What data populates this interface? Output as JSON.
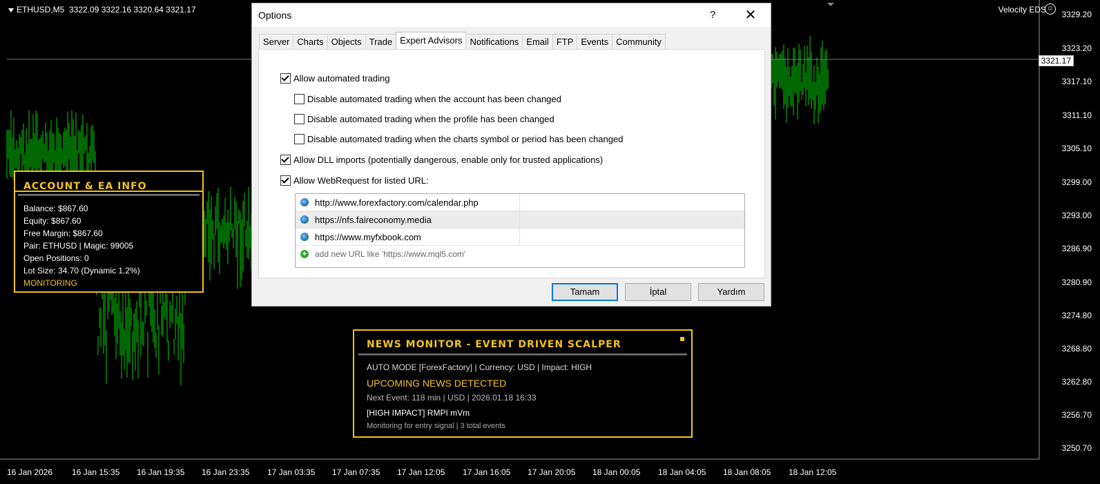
{
  "chart": {
    "header": "ETHUSD,M5  3322.09 3322.16 3320.64 3321.17",
    "ea_name": "Velocity EDS",
    "current_price": "3321.17",
    "price_labels": [
      "3329.20",
      "3323.20",
      "3317.10",
      "3311.10",
      "3305.10",
      "3299.00",
      "3293.00",
      "3286.90",
      "3280.90",
      "3274.80",
      "3268.80",
      "3262.80",
      "3256.70",
      "3250.70"
    ],
    "time_labels": [
      "16 Jan 2026",
      "16 Jan 15:35",
      "16 Jan 19:35",
      "16 Jan 23:35",
      "17 Jan 03:35",
      "17 Jan 07:35",
      "17 Jan 12:05",
      "17 Jan 16:05",
      "17 Jan 20:05",
      "18 Jan 00:05",
      "18 Jan 04:05",
      "18 Jan 08:05",
      "18 Jan 12:05"
    ],
    "colors": {
      "bars": "#00d000",
      "background": "#000000",
      "accent": "#f2c417"
    }
  },
  "account_panel": {
    "title": "ACCOUNT & EA INFO",
    "balance": "Balance: $867.60",
    "equity": "Equity: $867.60",
    "free_margin": "Free Margin: $867.60",
    "pair": "Pair: ETHUSD | Magic: 99005",
    "open_positions": "Open Positions: 0",
    "lot_size": "Lot Size: 34.70 (Dynamic 1.2%)",
    "status": "MONITORING"
  },
  "news_panel": {
    "title": "NEWS MONITOR - EVENT DRIVEN SCALPER",
    "mode": "AUTO MODE [ForexFactory]  |  Currency: USD  |  Impact: HIGH",
    "status": "UPCOMING NEWS DETECTED",
    "next_event": "Next Event: 118 min  |  USD  |  2026.01.18 16:33",
    "impact": "[HIGH IMPACT]  RMPI mVm",
    "footer": "Monitoring for entry signal  |  3 total events"
  },
  "dialog": {
    "title": "Options",
    "help": "?",
    "close": "✕",
    "tabs": [
      "Server",
      "Charts",
      "Objects",
      "Trade",
      "Expert Advisors",
      "Notifications",
      "Email",
      "FTP",
      "Events",
      "Community"
    ],
    "active_tab": "Expert Advisors",
    "options": {
      "allow_auto": {
        "label": "Allow automated trading",
        "checked": true
      },
      "disable_account": {
        "label": "Disable automated trading when the account has been changed",
        "checked": false
      },
      "disable_profile": {
        "label": "Disable automated trading when the profile has been changed",
        "checked": false
      },
      "disable_symbol": {
        "label": "Disable automated trading when the charts symbol or period has been changed",
        "checked": false
      },
      "allow_dll": {
        "label": "Allow DLL imports (potentially dangerous, enable only for trusted applications)",
        "checked": true
      },
      "allow_web": {
        "label": "Allow WebRequest for listed URL:",
        "checked": true
      }
    },
    "urls": [
      "http://www.forexfactory.com/calendar.php",
      "https://nfs.faireconomy.media",
      "https://www.myfxbook.com"
    ],
    "add_url_placeholder": "add new URL like 'https://www.mql5.com'",
    "buttons": {
      "ok": "Tamam",
      "cancel": "İptal",
      "help": "Yardım"
    }
  }
}
